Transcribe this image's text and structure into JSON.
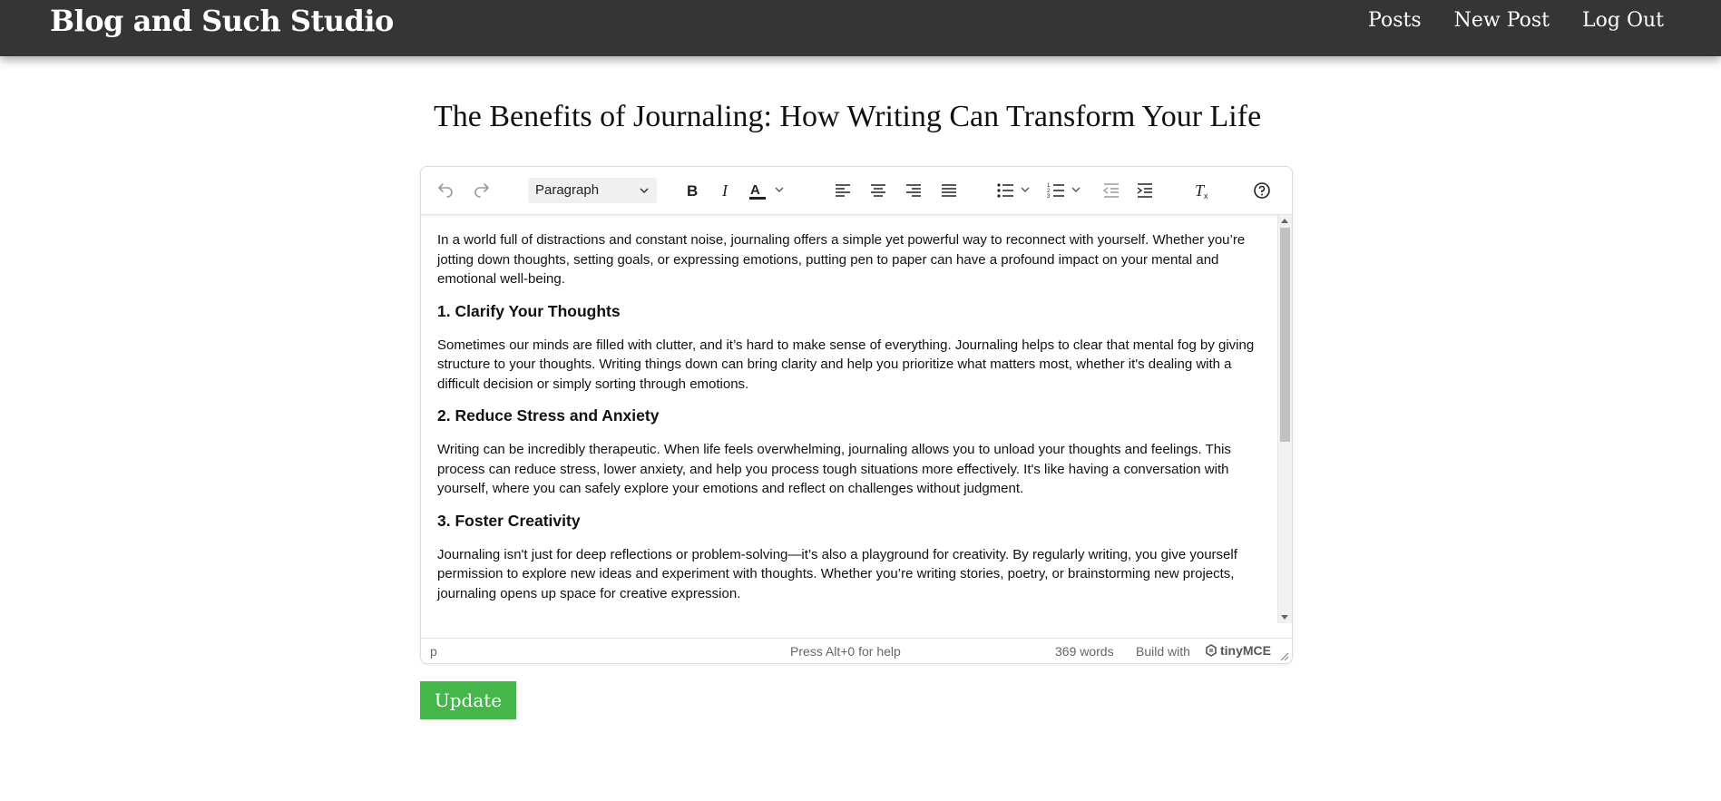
{
  "navbar": {
    "brand": "Blog and Such Studio",
    "links": [
      "Posts",
      "New Post",
      "Log Out"
    ]
  },
  "post": {
    "title": "The Benefits of Journaling: How Writing Can Transform Your Life"
  },
  "toolbar": {
    "format_select": "Paragraph",
    "buttons": [
      "undo",
      "redo",
      "bold",
      "italic",
      "text-color",
      "align-left",
      "align-center",
      "align-right",
      "justify",
      "bullet-list",
      "numbered-list",
      "outdent",
      "indent",
      "clear-formatting",
      "help"
    ]
  },
  "content": {
    "intro": "In a world full of distractions and constant noise, journaling offers a simple yet powerful way to reconnect with yourself. Whether you’re jotting down thoughts, setting goals, or expressing emotions, putting pen to paper can have a profound impact on your mental and emotional well-being.",
    "sections": [
      {
        "heading": "1. Clarify Your Thoughts",
        "body": "Sometimes our minds are filled with clutter, and it’s hard to make sense of everything. Journaling helps to clear that mental fog by giving structure to your thoughts. Writing things down can bring clarity and help you prioritize what matters most, whether it's dealing with a difficult decision or simply sorting through emotions."
      },
      {
        "heading": "2. Reduce Stress and Anxiety",
        "body": "Writing can be incredibly therapeutic. When life feels overwhelming, journaling allows you to unload your thoughts and feelings. This process can reduce stress, lower anxiety, and help you process tough situations more effectively. It's like having a conversation with yourself, where you can safely explore your emotions and reflect on challenges without judgment."
      },
      {
        "heading": "3. Foster Creativity",
        "body": "Journaling isn't just for deep reflections or problem-solving—it’s also a playground for creativity. By regularly writing, you give yourself permission to explore new ideas and experiment with thoughts. Whether you’re writing stories, poetry, or brainstorming new projects, journaling opens up space for creative expression."
      }
    ]
  },
  "statusbar": {
    "path": "p",
    "help": "Press Alt+0 for help",
    "words": "369 words",
    "build": "Build with",
    "brand": "tinyMCE"
  },
  "actions": {
    "update_label": "Update"
  },
  "colors": {
    "navbar": "#353535",
    "update_button": "#45b649"
  }
}
